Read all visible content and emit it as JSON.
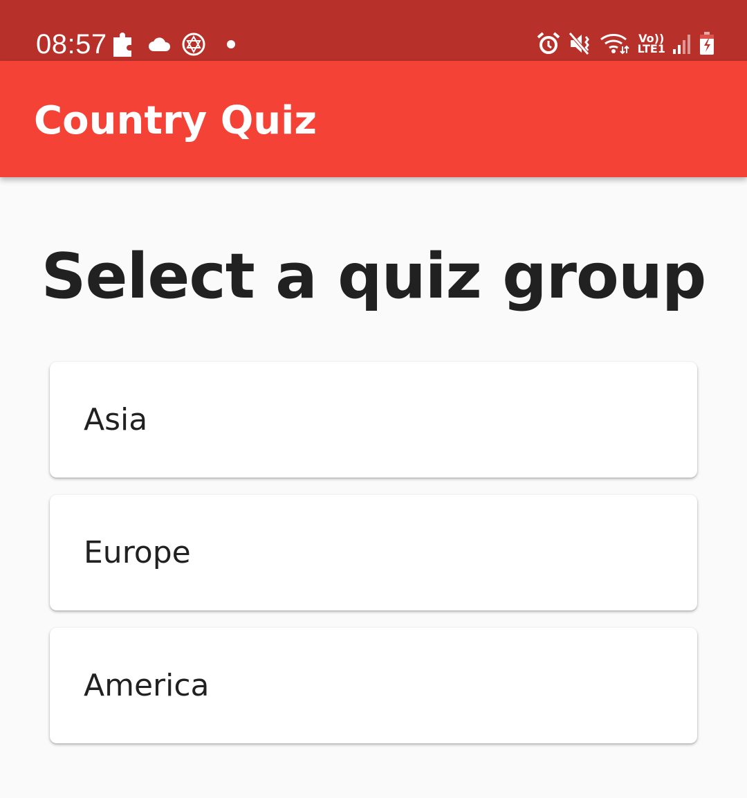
{
  "status_bar": {
    "time": "08:57",
    "left_icons": [
      "puzzle-icon",
      "cloud-icon",
      "star-of-david-icon",
      "notification-dot-icon"
    ],
    "right_icons": [
      "alarm-icon",
      "vibrate-icon",
      "wifi-icon",
      "volte-icon",
      "signal-icon",
      "battery-charging-icon"
    ],
    "network_label_top": "Vo))",
    "network_label_bottom": "LTE1"
  },
  "app_bar": {
    "title": "Country Quiz",
    "color": "#f44336"
  },
  "main": {
    "heading": "Select a quiz group",
    "groups": [
      {
        "label": "Asia"
      },
      {
        "label": "Europe"
      },
      {
        "label": "America"
      }
    ]
  },
  "colors": {
    "status_bar": "#b8302a",
    "app_bar": "#f44336",
    "background": "#fafafa",
    "card": "#ffffff",
    "text": "#212121"
  }
}
